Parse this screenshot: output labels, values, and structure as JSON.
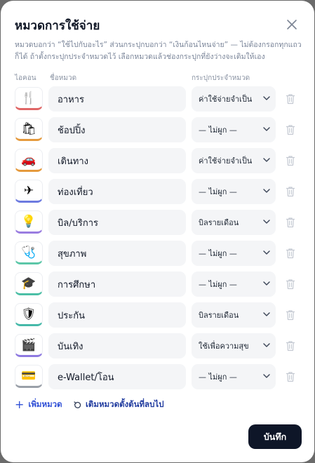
{
  "modal": {
    "title": "หมวดการใช้จ่าย",
    "description": "หมวดบอกว่า “ใช้ไปกับอะไร” ส่วนกระปุกบอกว่า “เงินก้อนไหนจ่าย” — ไม่ต้องกรอกทุกแถว ก็ได้ ถ้าตั้งกระปุกประจำหมวดไว้ เลือกหมวดแล้วช่องกระปุกที่ยังว่างจะเติมให้เอง"
  },
  "headers": {
    "icon": "ไอคอน",
    "name": "ชื่อหมวด",
    "jar": "กระปุกประจำหมวด"
  },
  "rows": [
    {
      "icon": "🍴",
      "icon_name": "fork-knife-icon",
      "accent": "#e06666",
      "name": "อาหาร",
      "jar": "ค่าใช้จ่ายจำเป็น"
    },
    {
      "icon": "🛍",
      "icon_name": "shopping-bags-icon",
      "accent": "#e59a3d",
      "name": "ช้อปปิ้ง",
      "jar": "— ไม่ผูก —"
    },
    {
      "icon": "🚗",
      "icon_name": "car-icon",
      "accent": "#e59a3d",
      "name": "เดินทาง",
      "jar": "ค่าใช้จ่ายจำเป็น"
    },
    {
      "icon": "✈",
      "icon_name": "airplane-icon",
      "accent": "#6d7be0",
      "name": "ท่องเที่ยว",
      "jar": "— ไม่ผูก —"
    },
    {
      "icon": "💡",
      "icon_name": "light-bulb-icon",
      "accent": "#9a7de0",
      "name": "บิล/บริการ",
      "jar": "บิลรายเดือน"
    },
    {
      "icon": "🩺",
      "icon_name": "stethoscope-icon",
      "accent": "#5cc7a8",
      "name": "สุขภาพ",
      "jar": "— ไม่ผูก —"
    },
    {
      "icon": "🎓",
      "icon_name": "graduation-cap-icon",
      "accent": "#4cbfa6",
      "name": "การศึกษา",
      "jar": "— ไม่ผูก —"
    },
    {
      "icon": "🛡",
      "icon_name": "shield-icon",
      "accent": "#46b9a9",
      "name": "ประกัน",
      "jar": "บิลรายเดือน"
    },
    {
      "icon": "🎬",
      "icon_name": "clapper-board-icon",
      "accent": "#8e79e0",
      "name": "บันเทิง",
      "jar": "ใช้เพื่อความสุข"
    },
    {
      "icon": "💳",
      "icon_name": "credit-card-icon",
      "accent": "#9aa0a8",
      "name": "e-Wallet/โอน",
      "jar": "— ไม่ผูก —"
    }
  ],
  "actions": {
    "add_label": "เพิ่มหมวด",
    "restore_label": "เติมหมวดตั้งต้นที่ลบไป",
    "save_label": "บันทึก"
  },
  "colors": {
    "primary_dark": "#0e1628",
    "link_blue": "#2f4fd6"
  }
}
